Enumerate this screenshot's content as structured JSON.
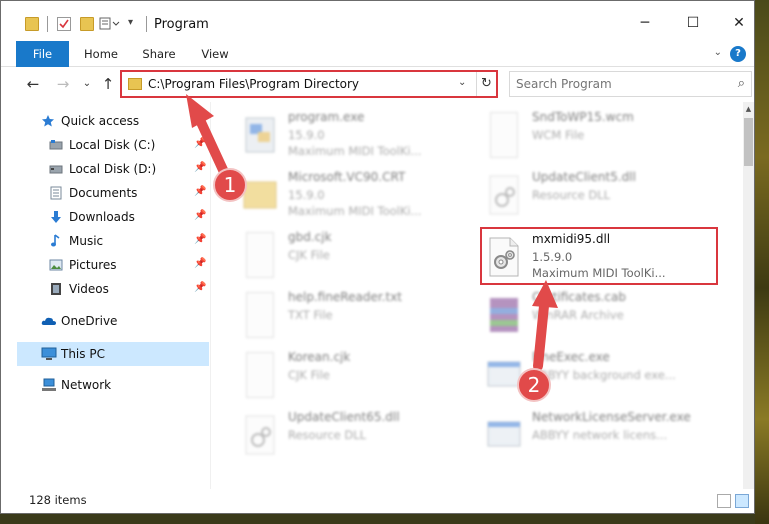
{
  "window": {
    "title": "Program",
    "controls": {
      "minimize": "─",
      "maximize": "☐",
      "close": "✕"
    }
  },
  "ribbon": {
    "tabs": [
      {
        "label": "File",
        "active": true
      },
      {
        "label": "Home"
      },
      {
        "label": "Share"
      },
      {
        "label": "View"
      }
    ],
    "help": "?"
  },
  "nav": {
    "back": "←",
    "forward": "→",
    "recent": "⌄",
    "up": "↑",
    "address": "C:\\Program Files\\Program Directory",
    "search_placeholder": "Search Program"
  },
  "sidebar": {
    "items": [
      {
        "label": "Quick access",
        "icon": "star-icon"
      },
      {
        "label": "Local Disk (C:)",
        "icon": "drive-icon",
        "pinned": true
      },
      {
        "label": "Local Disk (D:)",
        "icon": "drive-icon",
        "pinned": true
      },
      {
        "label": "Documents",
        "icon": "documents-icon",
        "pinned": true
      },
      {
        "label": "Downloads",
        "icon": "downloads-icon",
        "pinned": true
      },
      {
        "label": "Music",
        "icon": "music-icon",
        "pinned": true
      },
      {
        "label": "Pictures",
        "icon": "pictures-icon",
        "pinned": true
      },
      {
        "label": "Videos",
        "icon": "videos-icon",
        "pinned": true
      },
      {
        "label": "OneDrive",
        "icon": "cloud-icon"
      },
      {
        "label": "This PC",
        "icon": "computer-icon",
        "selected": true
      },
      {
        "label": "Network",
        "icon": "network-icon"
      }
    ],
    "pin_glyph": "📌"
  },
  "files": {
    "left": [
      {
        "name": "program.exe",
        "line1": "15.9.0",
        "line2": "Maximum MIDI ToolKi..."
      },
      {
        "name": "Microsoft.VC90.CRT",
        "line1": "15.9.0",
        "line2": "Maximum MIDI ToolKi..."
      },
      {
        "name": "gbd.cjk",
        "line1": "CJK File",
        "line2": ""
      },
      {
        "name": "help.fineReader.txt",
        "line1": "TXT File",
        "line2": ""
      },
      {
        "name": "Korean.cjk",
        "line1": "CJK File",
        "line2": ""
      },
      {
        "name": "UpdateClient65.dll",
        "line1": "Resource DLL",
        "line2": ""
      }
    ],
    "right": [
      {
        "name": "SndToWP15.wcm",
        "line1": "WCM File",
        "line2": ""
      },
      {
        "name": "UpdateClient5.dll",
        "line1": "Resource DLL",
        "line2": ""
      },
      {
        "name": "mxmidi95.dll",
        "line1": "1.5.9.0",
        "line2": "Maximum MIDI ToolKi..."
      },
      {
        "name": "Certificates.cab",
        "line1": "WinRAR Archive",
        "line2": ""
      },
      {
        "name": "FineExec.exe",
        "line1": "ABBYY background exe...",
        "line2": ""
      },
      {
        "name": "NetworkLicenseServer.exe",
        "line1": "ABBYY network licens...",
        "line2": ""
      }
    ]
  },
  "status": {
    "items": "128 items"
  },
  "annotations": {
    "step1": "1",
    "step2": "2",
    "color": "#e14a4a",
    "box_color": "#d9363e"
  }
}
